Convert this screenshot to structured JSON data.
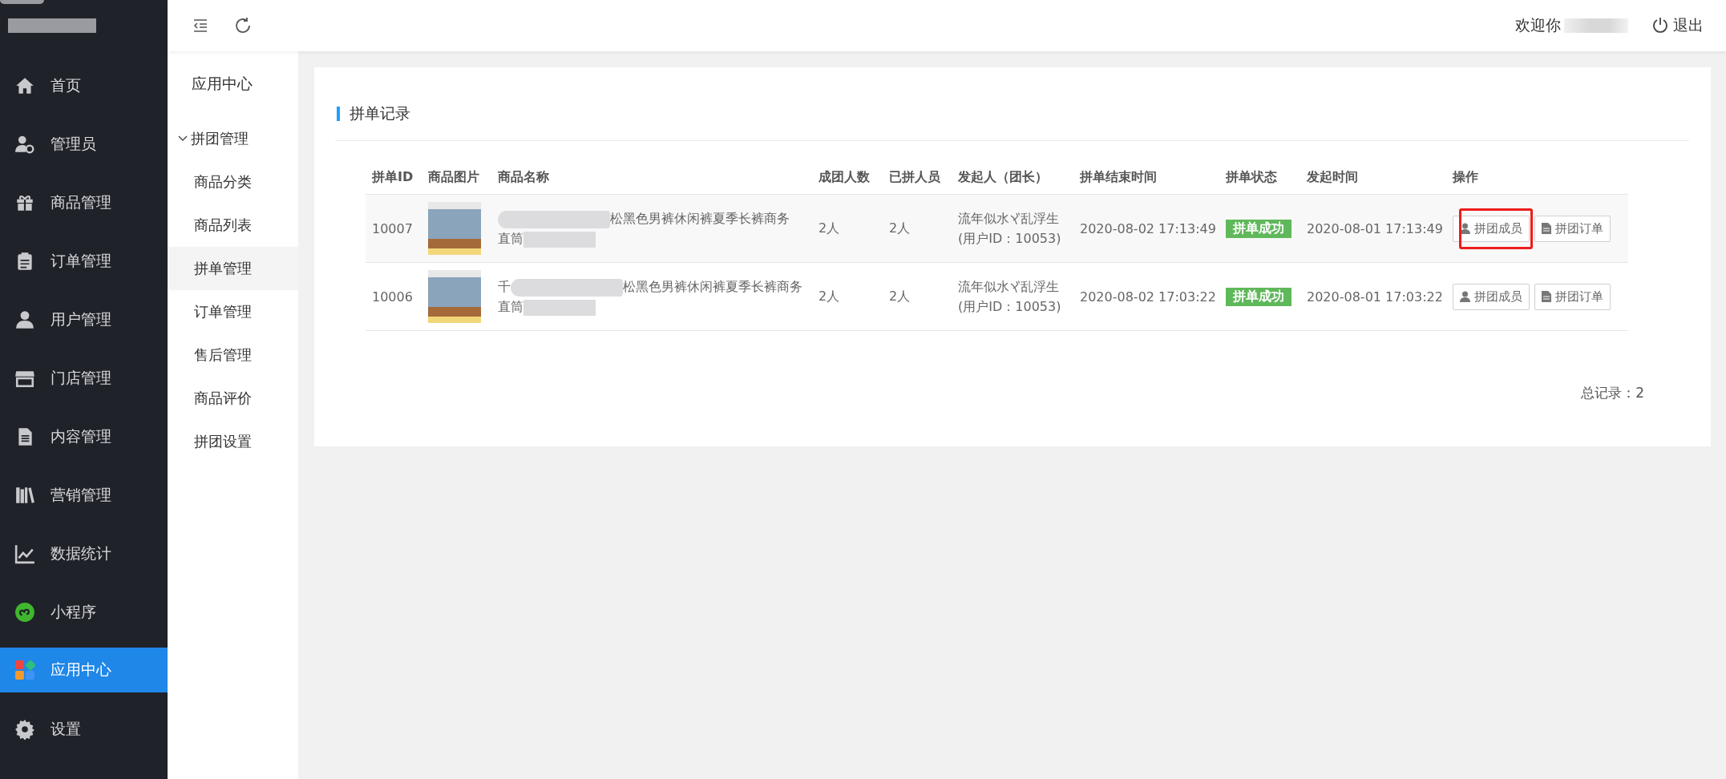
{
  "sidebar": {
    "items": [
      {
        "label": "首页",
        "selected": false
      },
      {
        "label": "管理员",
        "selected": false
      },
      {
        "label": "商品管理",
        "selected": false
      },
      {
        "label": "订单管理",
        "selected": false
      },
      {
        "label": "用户管理",
        "selected": false
      },
      {
        "label": "门店管理",
        "selected": false
      },
      {
        "label": "内容管理",
        "selected": false
      },
      {
        "label": "营销管理",
        "selected": false
      },
      {
        "label": "数据统计",
        "selected": false
      },
      {
        "label": "小程序",
        "selected": false
      },
      {
        "label": "应用中心",
        "selected": true
      },
      {
        "label": "设置",
        "selected": false
      }
    ]
  },
  "submenu": {
    "title": "应用中心",
    "group": {
      "label": "拼团管理",
      "expanded": true,
      "children": [
        {
          "label": "商品分类",
          "selected": false
        },
        {
          "label": "商品列表",
          "selected": false
        },
        {
          "label": "拼单管理",
          "selected": true
        },
        {
          "label": "订单管理",
          "selected": false
        },
        {
          "label": "售后管理",
          "selected": false
        },
        {
          "label": "商品评价",
          "selected": false
        },
        {
          "label": "拼团设置",
          "selected": false
        }
      ]
    }
  },
  "topbar": {
    "welcome": "欢迎你",
    "logout": "退出"
  },
  "card": {
    "title": "拼单记录",
    "table": {
      "columns": [
        "拼单ID",
        "商品图片",
        "商品名称",
        "成团人数",
        "已拼人员",
        "发起人（团长）",
        "拼单结束时间",
        "拼单状态",
        "发起时间",
        "操作"
      ],
      "rows": [
        {
          "id": "10007",
          "name_prefix": "",
          "name": "松黑色男裤休闲裤夏季长裤商务",
          "name_line_2": "直筒",
          "target": "2人",
          "joined": "2人",
          "initiator": [
            "流年似水",
            "乱浮生"
          ],
          "initiator_id": "(用户ID：10053)",
          "end_time": "2020-08-02 17:13:49",
          "status": "拼单成功",
          "start_time": "2020-08-01 17:13:49",
          "actions": [
            {
              "label": "拼团成员",
              "highlighted": true
            },
            {
              "label": "拼团订单",
              "highlighted": false
            }
          ]
        },
        {
          "id": "10006",
          "name_prefix": "千",
          "name": "松黑色男裤休闲裤夏季长裤商务",
          "name_line_2": "直筒",
          "target": "2人",
          "joined": "2人",
          "initiator": [
            "流年似水",
            "乱浮生"
          ],
          "initiator_id": "(用户ID：10053)",
          "end_time": "2020-08-02 17:03:22",
          "status": "拼单成功",
          "start_time": "2020-08-01 17:03:22",
          "actions": [
            {
              "label": "拼团成员",
              "highlighted": false
            },
            {
              "label": "拼团订单",
              "highlighted": false
            }
          ]
        }
      ]
    },
    "total": "总记录：2"
  }
}
